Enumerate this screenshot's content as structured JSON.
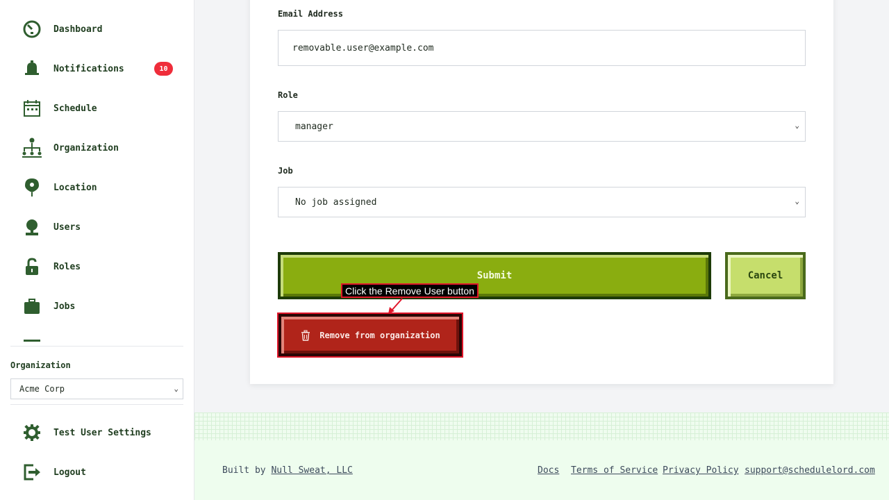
{
  "sidebar": {
    "items": [
      {
        "label": "Dashboard",
        "icon": "dashboard-icon"
      },
      {
        "label": "Notifications",
        "icon": "bell-icon",
        "badge": "10"
      },
      {
        "label": "Schedule",
        "icon": "calendar-icon"
      },
      {
        "label": "Organization",
        "icon": "org-chart-icon"
      },
      {
        "label": "Location",
        "icon": "map-pin-icon"
      },
      {
        "label": "Users",
        "icon": "user-icon"
      },
      {
        "label": "Roles",
        "icon": "lock-icon"
      },
      {
        "label": "Jobs",
        "icon": "briefcase-icon"
      }
    ],
    "organization_label": "Organization",
    "organization_value": "Acme Corp",
    "bottom_items": [
      {
        "label": "Test User Settings",
        "icon": "gear-icon"
      },
      {
        "label": "Logout",
        "icon": "logout-icon"
      }
    ]
  },
  "form": {
    "email_label": "Email Address",
    "email_value": "removable.user@example.com",
    "role_label": "Role",
    "role_value": "manager",
    "job_label": "Job",
    "job_value": "No job assigned",
    "submit_label": "Submit",
    "cancel_label": "Cancel",
    "remove_label": "Remove from organization"
  },
  "annotation": {
    "tooltip": "Click the Remove User button"
  },
  "footer": {
    "built_by_prefix": "Built by",
    "built_by_link": "Null Sweat, LLC",
    "links": [
      "Docs",
      "Terms of Service",
      "Privacy Policy",
      "support@schedulelord.com"
    ]
  },
  "colors": {
    "accent_green": "#8aad10",
    "cancel_green": "#c6de6c",
    "danger_red": "#b0241a",
    "badge_red": "#ef2d3a",
    "icon_green": "#2f5e2f"
  }
}
